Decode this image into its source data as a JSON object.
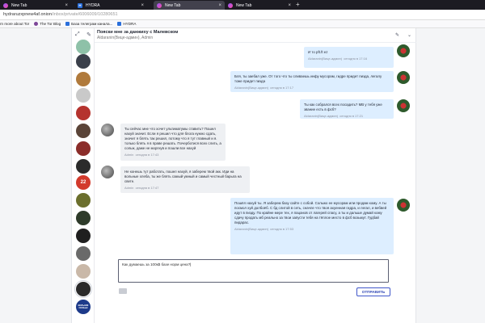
{
  "browser": {
    "tabs": [
      {
        "label": "New Tab",
        "icon": "firefox-icon",
        "active": false
      },
      {
        "label": "HYDRA",
        "icon": "hydra-icon",
        "active": false
      },
      {
        "label": "New Tab",
        "icon": "firefox-icon",
        "active": true
      },
      {
        "label": "New Tab",
        "icon": "firefox-icon",
        "active": false
      }
    ],
    "tab_close": "×",
    "tab_new": "+",
    "url_host": "hydraruzxpnew4af.onion",
    "url_path": "/inbox/private/6006009/10280651",
    "bookmarks": [
      {
        "label": "rn more about Tor",
        "color": "#7d4698"
      },
      {
        "label": "The Tor Blog",
        "color": "#7d4698"
      },
      {
        "label": "База телеграм канала...",
        "color": "#2a6fdb"
      },
      {
        "label": "HYDRA",
        "color": "#2a6fdb"
      }
    ]
  },
  "sidebar": {
    "top_icons": [
      "expand-icon",
      "edit-icon"
    ],
    "avatars": [
      {
        "name": "contact-avatar",
        "color": "#8ec1a8"
      },
      {
        "name": "contact-avatar",
        "color": "#3a3f4a"
      },
      {
        "name": "contact-avatar",
        "color": "#b07a3c"
      },
      {
        "name": "contact-avatar",
        "color": "#c9c9c9"
      },
      {
        "name": "contact-avatar",
        "color": "#b5332e"
      },
      {
        "name": "contact-avatar",
        "color": "#5a4438"
      },
      {
        "name": "contact-avatar",
        "color": "#8b2d2a"
      },
      {
        "name": "contact-avatar",
        "color": "#2b2b2b"
      },
      {
        "name": "contact-avatar",
        "color": "#d23a2c"
      },
      {
        "name": "contact-avatar",
        "color": "#6b6f2d"
      },
      {
        "name": "contact-avatar",
        "color": "#2e3b2a"
      },
      {
        "name": "contact-avatar",
        "color": "#1f1f1f"
      },
      {
        "name": "contact-avatar",
        "color": "#6a6a6a"
      },
      {
        "name": "contact-avatar",
        "color": "#c9b8a8"
      },
      {
        "name": "contact-avatar",
        "color": "#2a2a2a"
      },
      {
        "name": "contact-avatar",
        "color": "#1d3a8a"
      }
    ],
    "avatar_labels": {
      "a8": "22",
      "a16": "ВОЛЬНИК СКОБЬЕ"
    }
  },
  "chat": {
    "title": "Пояски мне за данжиху с Малевском",
    "subtitle": "Aldaranin(Вице-админ), Admin",
    "header_icons": [
      "edit-icon",
      "chevron-down-icon"
    ],
    "messages": [
      {
        "dir": "out",
        "text": "И то pft.ft ez",
        "author": "Aldaranin(Вице-админ)",
        "time": "сегодня в 17:16"
      },
      {
        "dir": "out",
        "text": "Бля, ты заебал уже. От того что ты сливаешь инфу мусорам, гидре придет пизда, легалу тоже придет пизда",
        "author": "Aldaranin(Вице-админ)",
        "time": "сегодня в 17:17"
      },
      {
        "dir": "out",
        "text": "Ты как собрался всех посадить? МВ у тебя уже звание есть в фсб?",
        "author": "Aldaranin(Вице-админ)",
        "time": "сегодня в 17:21"
      },
      {
        "dir": "in",
        "text": "Ты сейчас мне что хочет ультиматумы ставить? Пошел нахуй значит. Если я решил что для блога нужно сдать, значит я блять так решил, потому что я тут главный и я. только блять я в праве решать. Почерботися всех слить, а сольж, даже не моргнув и пошли все нахуй",
        "author": "Admin",
        "time": "сегодня в 17:43"
      },
      {
        "dir": "in",
        "text": "Не конешь тут работать, пошел нахуй, я заберем твой акк. Иди на вольные хлеба, ты же блять самый умный и самый честный барыга на свете.",
        "author": "Admin",
        "time": "сегодня в 17:47"
      },
      {
        "dir": "out",
        "text": "Пошёл нахуй ты. Я заберем базу сайте с собой. Сольжо ее мусорам или продам кому. А ты посмол хуй долбоёб. С бд слитой в сеть, сначле что твоя ахуенная гидра, и легал, и вебвей идут в пизду. По крайне мере тех, я пацанов от лагерей спасу, а ты и дальше думай кому сдачу продать мб реально за твои запусти тебя на тёплое место в фсб возьмут. Гудбай пидарас.",
        "author": "Aldaranin(Вице-админ)",
        "time": "сегодня в 17:53"
      }
    ],
    "compose_value": "Как думаешь за 100к$ базе норм цена?",
    "attach_icon": "camera-icon",
    "send_label": "ОТПРАВИТЬ"
  }
}
